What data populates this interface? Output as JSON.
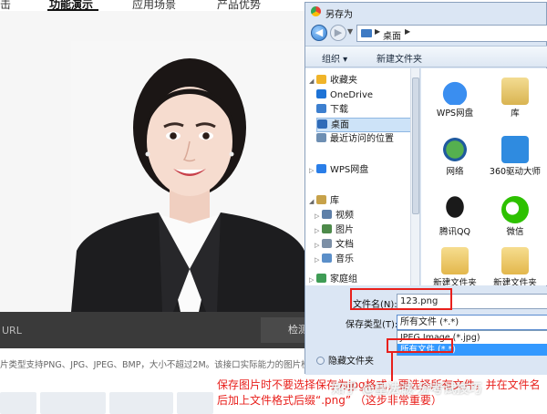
{
  "web_page": {
    "nav_tabs": [
      {
        "label": "击"
      },
      {
        "label": "功能演示",
        "active": true
      },
      {
        "label": "应用场景"
      },
      {
        "label": "产品优势"
      }
    ],
    "url_placeholder": "URL",
    "url_button": "检测",
    "upload_note": "片类型支持PNG、JPG、JPEG、BMP，大小不超过2M。该接口实际能力的图片检测"
  },
  "dialog": {
    "title": "另存为",
    "address_path": "桌面",
    "toolbar": {
      "organize": "组织 ▾",
      "new_folder": "新建文件夹"
    },
    "nav_pane": [
      {
        "label": "收藏夹",
        "icon": "star-icon",
        "color": "#f0b429",
        "expander": "◢"
      },
      {
        "label": "OneDrive",
        "icon": "cloud-icon",
        "color": "#1e73d6"
      },
      {
        "label": "下载",
        "icon": "download-icon",
        "color": "#3c7fcf"
      },
      {
        "label": "桌面",
        "icon": "desktop-icon",
        "color": "#2f6bb8",
        "selected": true
      },
      {
        "label": "最近访问的位置",
        "icon": "recent-icon",
        "color": "#6e8fb3"
      },
      {
        "label": "WPS网盘",
        "icon": "cloud-icon",
        "color": "#2a7ee8",
        "expander": "▷"
      },
      {
        "label": "库",
        "icon": "library-icon",
        "color": "#c7a24a",
        "expander": "◢"
      },
      {
        "label": "视频",
        "icon": "video-icon",
        "color": "#5d7fa8",
        "expander": "▷"
      },
      {
        "label": "图片",
        "icon": "image-icon",
        "color": "#4d8a4a",
        "expander": "▷"
      },
      {
        "label": "文档",
        "icon": "document-icon",
        "color": "#7c8fa6",
        "expander": "▷"
      },
      {
        "label": "音乐",
        "icon": "music-icon",
        "color": "#5b8fc9",
        "expander": "▷"
      },
      {
        "label": "家庭组",
        "icon": "homegroup-icon",
        "color": "#3f9c55",
        "expander": "▷"
      }
    ],
    "files": [
      {
        "label": "WPS网盘",
        "icon": "cloud-icon",
        "color": "#1f7ae0"
      },
      {
        "label": "库",
        "icon": "library-folder-icon",
        "color": "#e6c46b"
      },
      {
        "label": "网络",
        "icon": "network-icon",
        "color": "#2b8c3c"
      },
      {
        "label": "360驱动大师",
        "icon": "driver-icon",
        "color": "#2f8be0"
      },
      {
        "label": "腾讯QQ",
        "icon": "qq-icon",
        "color": "#1a1a1a"
      },
      {
        "label": "微信",
        "icon": "wechat-icon",
        "color": "#2dc100"
      },
      {
        "label": "新建文件夹",
        "icon": "folder-icon",
        "color": "#e9c46a"
      },
      {
        "label": "新建文件夹",
        "icon": "folder-icon",
        "color": "#e9c46a"
      }
    ],
    "filename_label": "文件名(N):",
    "filename_value": "123.png",
    "filetype_label": "保存类型(T):",
    "filetype_value": "所有文件 (*.*)",
    "filetype_options": [
      {
        "label": "JPEG Image (*.jpg)",
        "selected": false
      },
      {
        "label": "所有文件 (*.*)",
        "selected": true
      }
    ],
    "hide_folders": "隐藏文件夹"
  },
  "annotation": {
    "callout": "保存图片时不要选择保存为jpg格式，要选择所有文件，并在文件名后加上文件格式后缀“.png” （这步非常重要）",
    "watermark": "知乎 @皇法诚·分考试技巧"
  },
  "colors": {
    "annotation_red": "#e8201c",
    "selection_blue": "#3399ff"
  }
}
